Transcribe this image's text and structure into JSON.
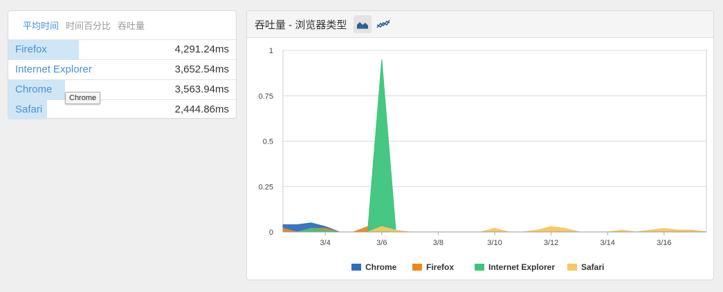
{
  "left": {
    "tabs": [
      "平均时间",
      "时间百分比",
      "吞吐量"
    ],
    "active_tab": 0,
    "rows": [
      {
        "name": "Firefox",
        "value": "4,291.24ms",
        "fraction": 0.31
      },
      {
        "name": "Internet Explorer",
        "value": "3,652.54ms",
        "fraction": 0.0
      },
      {
        "name": "Chrome",
        "value": "3,563.94ms",
        "fraction": 0.25
      },
      {
        "name": "Safari",
        "value": "2,444.86ms",
        "fraction": 0.17
      }
    ],
    "tooltip": "Chrome"
  },
  "right": {
    "title": "吞吐量 - 浏览器类型",
    "chart_buttons": [
      {
        "icon": "area-chart-icon",
        "active": true
      },
      {
        "icon": "line-chart-icon",
        "active": false
      }
    ]
  },
  "colors": {
    "Chrome": "#2f6fbf",
    "Firefox": "#f0861a",
    "Internet Explorer": "#3cc47c",
    "Safari": "#f6c85f",
    "accent": "#4a90d9"
  },
  "chart_data": {
    "type": "area",
    "title": "",
    "xlabel": "",
    "ylabel": "",
    "ylim": [
      0,
      1
    ],
    "yticks": [
      0,
      0.25,
      0.5,
      0.75,
      1
    ],
    "ytick_labels": [
      "0",
      "0.25",
      "0.5",
      "0.75",
      "1"
    ],
    "xlim": [
      2.5,
      17.5
    ],
    "xticks": [
      4,
      6,
      8,
      10,
      12,
      14,
      16
    ],
    "xtick_labels": [
      "3/4",
      "3/6",
      "3/8",
      "3/10",
      "3/12",
      "3/14",
      "3/16"
    ],
    "x": [
      2.5,
      3,
      3.5,
      4,
      4.5,
      5,
      5.5,
      6,
      6.5,
      7,
      7.5,
      8,
      8.5,
      9,
      9.5,
      10,
      10.5,
      11,
      11.5,
      12,
      12.5,
      13,
      13.5,
      14,
      14.5,
      15,
      15.5,
      16,
      16.5,
      17,
      17.5
    ],
    "legend_position": "bottom",
    "grid": true,
    "series": [
      {
        "name": "Chrome",
        "values": [
          0.04,
          0.04,
          0.05,
          0.03,
          0,
          0,
          0,
          0,
          0,
          0,
          0,
          0,
          0,
          0,
          0,
          0,
          0,
          0,
          0,
          0,
          0,
          0,
          0,
          0,
          0,
          0,
          0,
          0,
          0,
          0,
          0
        ]
      },
      {
        "name": "Firefox",
        "values": [
          0.02,
          0,
          0.02,
          0.02,
          0,
          0,
          0.03,
          0,
          0,
          0,
          0,
          0,
          0,
          0,
          0,
          0,
          0,
          0,
          0,
          0,
          0,
          0,
          0,
          0,
          0,
          0,
          0,
          0,
          0.01,
          0.01,
          0
        ]
      },
      {
        "name": "Internet Explorer",
        "values": [
          0,
          0,
          0.02,
          0.01,
          0,
          0,
          0,
          0.95,
          0,
          0,
          0,
          0,
          0,
          0,
          0,
          0,
          0,
          0,
          0,
          0,
          0,
          0,
          0,
          0,
          0,
          0,
          0,
          0,
          0,
          0,
          0
        ]
      },
      {
        "name": "Safari",
        "values": [
          0,
          0,
          0,
          0,
          0,
          0,
          0,
          0.03,
          0.01,
          0,
          0,
          0,
          0,
          0,
          0,
          0.02,
          0,
          0,
          0.01,
          0.03,
          0.02,
          0,
          0,
          0,
          0.01,
          0,
          0.01,
          0.02,
          0.01,
          0.01,
          0
        ]
      }
    ]
  }
}
